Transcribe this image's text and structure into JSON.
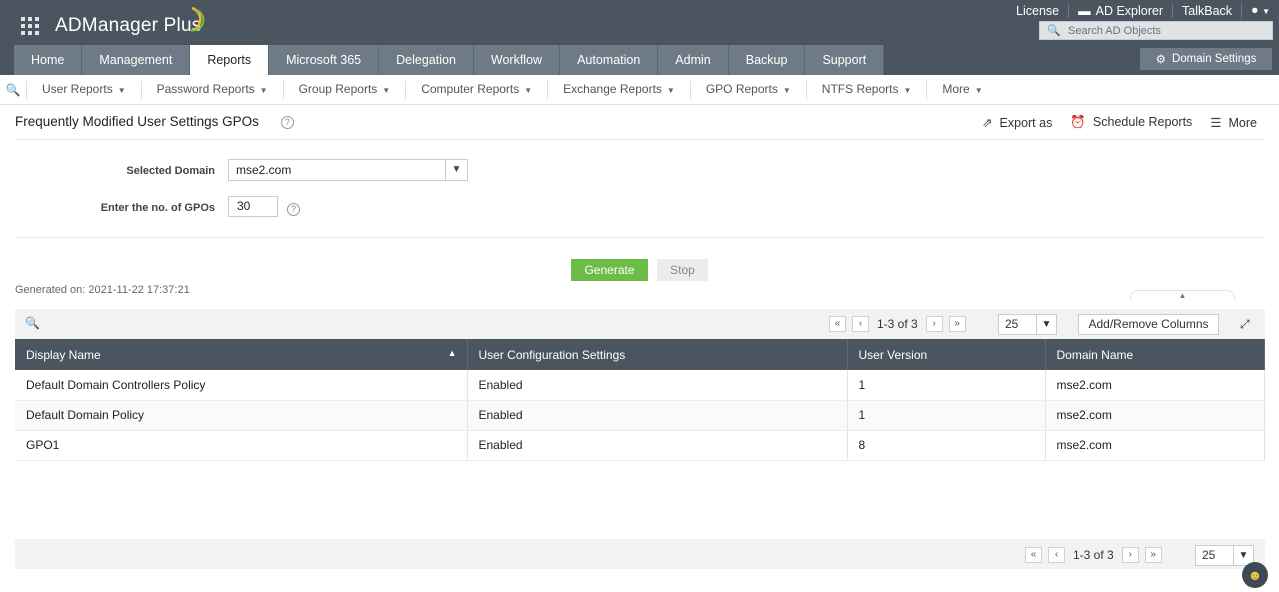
{
  "app": {
    "name": "ADManager Plus"
  },
  "toplinks": [
    "License",
    "AD Explorer",
    "TalkBack"
  ],
  "search": {
    "placeholder": "Search AD Objects"
  },
  "mainnav": [
    "Home",
    "Management",
    "Reports",
    "Microsoft 365",
    "Delegation",
    "Workflow",
    "Automation",
    "Admin",
    "Backup",
    "Support"
  ],
  "active_tab": "Reports",
  "domain_settings": "Domain Settings",
  "subnav": [
    "User Reports",
    "Password Reports",
    "Group Reports",
    "Computer Reports",
    "Exchange Reports",
    "GPO Reports",
    "NTFS Reports",
    "More"
  ],
  "report": {
    "title": "Frequently Modified User Settings GPOs",
    "actions": {
      "export": "Export as",
      "schedule": "Schedule Reports",
      "more": "More"
    },
    "domain_label": "Selected Domain",
    "domain_value": "mse2.com",
    "gpo_label": "Enter the no. of GPOs",
    "gpo_value": "30",
    "generate": "Generate",
    "stop": "Stop",
    "generated_on": "Generated on: 2021-11-22 17:37:21"
  },
  "pagination": {
    "range": "1-3 of 3",
    "page_size": "25"
  },
  "add_remove_columns": "Add/Remove Columns",
  "table": {
    "columns": [
      "Display Name",
      "User Configuration Settings",
      "User Version",
      "Domain Name"
    ],
    "rows": [
      [
        "Default Domain Controllers Policy",
        "Enabled",
        "1",
        "mse2.com"
      ],
      [
        "Default Domain Policy",
        "Enabled",
        "1",
        "mse2.com"
      ],
      [
        "GPO1",
        "Enabled",
        "8",
        "mse2.com"
      ]
    ]
  },
  "colors": {
    "header": "#4a5560",
    "tab": "#6e7b86",
    "accent": "#6cbd45"
  }
}
